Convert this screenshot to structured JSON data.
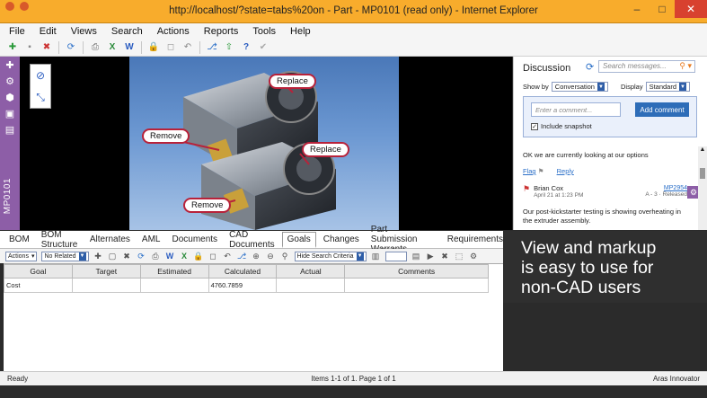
{
  "window": {
    "title": "http://localhost/?state=tabs%20on - Part - MP0101 (read only) - Internet Explorer"
  },
  "menu": [
    "File",
    "Edit",
    "Views",
    "Search",
    "Actions",
    "Reports",
    "Tools",
    "Help"
  ],
  "rail": {
    "label": "MP0101"
  },
  "viewer": {
    "labels": [
      "Replace",
      "Remove",
      "Replace",
      "Remove"
    ]
  },
  "discussion": {
    "title": "Discussion",
    "search_placeholder": "Search messages...",
    "sort_label": "Show by",
    "sort_value": "Conversation",
    "display_label": "Display",
    "display_value": "Standard",
    "comment_placeholder": "Enter a comment...",
    "add_comment": "Add comment",
    "include_snapshot": "Include snapshot",
    "post1_text": "OK we are currently looking at our options",
    "flag": "Flag",
    "reply": "Reply",
    "author": "Brian Cox",
    "date": "April 21 at 1:23 PM",
    "item": "MP2954",
    "rev": "A - 3 · Released",
    "post2_text": "Our post-kickstarter testing is showing overheating in the extruder assembly."
  },
  "tabs": [
    "BOM",
    "BOM Structure",
    "Alternates",
    "AML",
    "Documents",
    "CAD Documents",
    "Goals",
    "Changes",
    "Part Submission Warrants",
    "Requirements"
  ],
  "active_tab": "Goals",
  "grid_toolbar": {
    "actions": "Actions",
    "related": "No Related",
    "search_criteria": "Hide Search Criteria"
  },
  "grid": {
    "headers": [
      "Goal",
      "Target",
      "Estimated",
      "Calculated",
      "Actual",
      "Comments"
    ],
    "rows": [
      [
        "Cost",
        "",
        "",
        "4760.7859",
        "",
        ""
      ]
    ]
  },
  "overlay": {
    "lines": [
      "View and markup",
      "is easy to use for",
      "non-CAD users"
    ]
  },
  "status": {
    "left": "Ready",
    "middle": "Items 1-1 of 1. Page 1 of 1",
    "right": "Aras Innovator"
  }
}
